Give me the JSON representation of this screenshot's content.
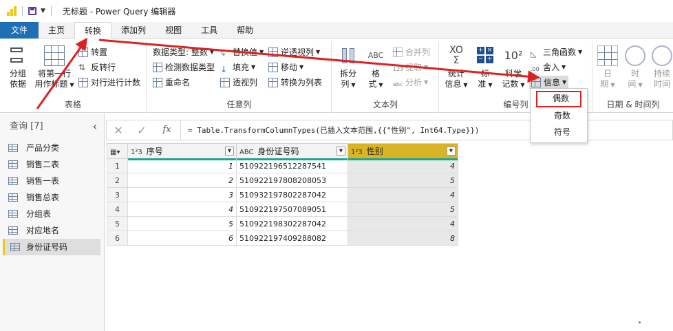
{
  "window": {
    "title": "无标题 - Power Query 编辑器"
  },
  "menu": {
    "tabs": [
      "文件",
      "主页",
      "转换",
      "添加列",
      "视图",
      "工具",
      "帮助"
    ],
    "active": "转换"
  },
  "ribbon": {
    "table_group": {
      "label": "表格",
      "group_by": "分组\n依据",
      "use_first_row_1": "将第一行",
      "use_first_row_2": "用作标题",
      "transpose": "转置",
      "reverse_rows": "反转行",
      "count_rows": "对行进行计数"
    },
    "any_column_group": {
      "label": "任意列",
      "data_type": "数据类型: 整数",
      "detect_type": "检测数据类型",
      "rename": "重命名",
      "replace_values": "替换值",
      "fill": "填充",
      "pivot_column": "透视列",
      "unpivot": "逆透视列",
      "move": "移动",
      "convert_to_list": "转换为列表"
    },
    "text_column_group": {
      "label": "文本列",
      "split_1": "拆分",
      "split_2": "列",
      "format_1": "格",
      "format_2": "式",
      "merge_columns": "合并列",
      "extract": "提取",
      "parse": "分析"
    },
    "number_column_group": {
      "label": "编号列",
      "statistics_1": "统计",
      "statistics_2": "信息",
      "standard_1": "标",
      "standard_2": "准",
      "scientific_1": "科学",
      "scientific_2": "记数",
      "trig": "三角函数",
      "rounding": "舍入",
      "information": "信息"
    },
    "datetime_group": {
      "label": "日期 & 时间列",
      "date_1": "日",
      "date_2": "期",
      "time_1": "时",
      "time_2": "间",
      "duration_1": "持续",
      "duration_2": "时间"
    }
  },
  "info_dropdown": {
    "items": [
      "偶数",
      "奇数",
      "符号"
    ],
    "highlighted": "偶数"
  },
  "queries": {
    "header": "查询 [7]",
    "items": [
      "产品分类",
      "销售二表",
      "销售一表",
      "销售总表",
      "分组表",
      "对应地名",
      "身份证号码"
    ],
    "selected": "身份证号码"
  },
  "formula_bar": {
    "cancel": "✕",
    "commit": "✓",
    "fx": "fx",
    "formula": "= Table.TransformColumnTypes(已插入文本范围,{{\"性别\", Int64.Type}})"
  },
  "table": {
    "columns": [
      {
        "type": "1²3",
        "name": "序号"
      },
      {
        "type": "ABC",
        "name": "身份证号码"
      },
      {
        "type": "1²3",
        "name": "性别"
      }
    ],
    "rows": [
      {
        "n": "1",
        "id": "1",
        "card": "510922196512287541",
        "sex": "4"
      },
      {
        "n": "2",
        "id": "2",
        "card": "510922197808208053",
        "sex": "5"
      },
      {
        "n": "3",
        "id": "3",
        "card": "510932197802287042",
        "sex": "4"
      },
      {
        "n": "4",
        "id": "4",
        "card": "510922197507089051",
        "sex": "5"
      },
      {
        "n": "5",
        "id": "5",
        "card": "510922198302287042",
        "sex": "4"
      },
      {
        "n": "6",
        "id": "6",
        "card": "510922197409288082",
        "sex": "8"
      }
    ]
  },
  "colors": {
    "accent_file": "#1f6fb5",
    "selected_column": "#d9b526",
    "arrow": "#e02020",
    "query_marker": "#f2c811"
  }
}
